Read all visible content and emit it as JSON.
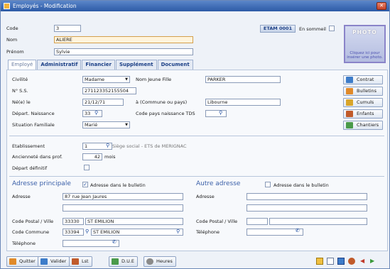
{
  "window": {
    "title": "Employés - Modification"
  },
  "header": {
    "code_label": "Code",
    "code_value": "3",
    "nom_label": "Nom",
    "nom_value": "ALIERE",
    "prenom_label": "Prénom",
    "prenom_value": "Sylvie",
    "etam_label": "ETAM 0001",
    "sommeil_label": "En sommeil",
    "photo_title": "PHOTO",
    "photo_hint": "Cliquez ici pour insérer une photo."
  },
  "tabs": [
    {
      "label": "Employé"
    },
    {
      "label": "Administratif"
    },
    {
      "label": "Financier"
    },
    {
      "label": "Supplément"
    },
    {
      "label": "Document"
    }
  ],
  "civil": {
    "civilite_label": "Civilité",
    "civilite_value": "Madame",
    "nom_jf_label": "Nom Jeune Fille",
    "nom_jf_value": "PARKER",
    "nss_label": "N° S.S.",
    "nss_value": "271123352155504",
    "nele_label": "Né(e) le",
    "nele_value": "21/12/71",
    "commune_label": "à (Commune ou pays)",
    "commune_value": "Libourne",
    "dept_label": "Départ. Naissance",
    "dept_value": "33",
    "code_pays_label": "Code pays naissance TDS",
    "situation_label": "Situation Familiale",
    "situation_value": "Marié"
  },
  "side_buttons": [
    {
      "label": "Contrat",
      "color": "#3d7cc9"
    },
    {
      "label": "Bulletins",
      "color": "#e08a2a"
    },
    {
      "label": "Cumuls",
      "color": "#d9a52b"
    },
    {
      "label": "Enfants",
      "color": "#c05a2a"
    },
    {
      "label": "Chantiers",
      "color": "#4a9a4a"
    }
  ],
  "etab": {
    "etab_label": "Etablissement",
    "etab_value": "1",
    "etab_desc": "Siège social - ETS de MERIGNAC",
    "anc_label": "Ancienneté dans prof.",
    "anc_value": "42",
    "anc_unit": "mois",
    "depart_label": "Départ définitif"
  },
  "adresse_principale": {
    "title": "Adresse principale",
    "bulletin_label": "Adresse dans le bulletin",
    "adresse_label": "Adresse",
    "adresse_value": "87 rue Jean Jaures",
    "cp_label": "Code Postal / Ville",
    "cp_value": "33330",
    "ville_value": "ST EMILION",
    "commune_label": "Code Commune",
    "commune_code": "33394",
    "commune_value": "ST EMILION",
    "tel_label": "Téléphone"
  },
  "autre_adresse": {
    "title": "Autre adresse",
    "bulletin_label": "Adresse dans le bulletin",
    "adresse_label": "Adresse",
    "cp_label": "Code Postal / Ville",
    "tel_label": "Téléphone"
  },
  "bottom_buttons": [
    {
      "label": "Quitter",
      "color": "#e08a2a"
    },
    {
      "label": "Valider",
      "color": "#3d7cc9"
    },
    {
      "label": "Lst",
      "color": "#c05a2a"
    },
    {
      "label": "D.U.E",
      "color": "#4a9a4a"
    },
    {
      "label": "Heures",
      "color": "#8a8a8a"
    }
  ]
}
